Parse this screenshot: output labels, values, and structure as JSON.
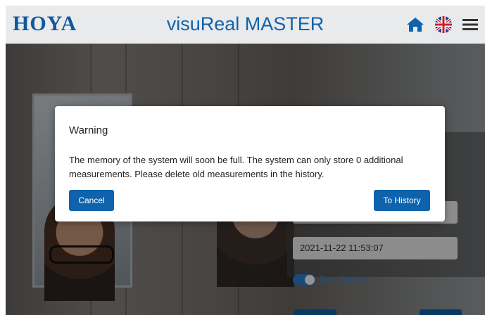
{
  "header": {
    "logo": "HOYA",
    "title": "visuReal MASTER",
    "icons": [
      "home-icon",
      "uk-flag-icon",
      "menu-icon"
    ]
  },
  "background": {
    "timestamp_field": "2021-11-22 11:53:07",
    "toggle_label": "Eye Catcher"
  },
  "dialog": {
    "title": "Warning",
    "message": "The memory of the system will soon be full. The system can only store 0 additional measurements. Please delete old measurements in the history.",
    "cancel_label": "Cancel",
    "history_label": "To History"
  },
  "colors": {
    "brand": "#0f63ad",
    "header_bg": "#e9eaec",
    "button_bg": "#0f63ad"
  }
}
